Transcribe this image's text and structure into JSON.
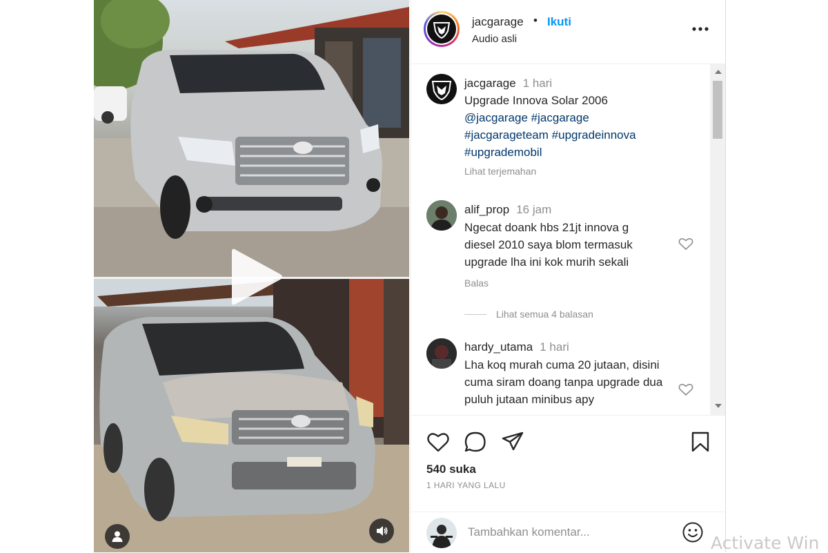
{
  "post": {
    "username": "jacgarage",
    "separator": "•",
    "follow_label": "Ikuti",
    "audio_label": "Audio asli",
    "more_icon": "more-horizontal-icon"
  },
  "caption": {
    "username": "jacgarage",
    "time": "1 hari",
    "title_line": "Upgrade Innova Solar 2006",
    "tags": [
      "@jacgarage",
      "#jacgarage",
      "#jacgarageteam",
      "#upgradeinnova",
      "#upgrademobil"
    ],
    "translate_label": "Lihat terjemahan"
  },
  "comments": [
    {
      "username": "alif_prop",
      "time": "16 jam",
      "text": "Ngecat doank hbs 21jt innova g diesel 2010 saya blom termasuk upgrade lha ini kok murih sekali",
      "reply_label": "Balas",
      "view_replies_label": "Lihat semua 4 balasan"
    },
    {
      "username": "hardy_utama",
      "time": "1 hari",
      "text": "Lha koq murah cuma 20 jutaan, disini cuma siram doang tanpa upgrade dua puluh jutaan minibus apy"
    }
  ],
  "actions": {
    "likes_label": "540 suka",
    "date_label": "1 HARI YANG LALU",
    "icons": [
      "heart-icon",
      "comment-icon",
      "share-icon",
      "bookmark-icon"
    ]
  },
  "add_comment": {
    "placeholder": "Tambahkan komentar...",
    "emoji_icon": "emoji-icon"
  },
  "watermark": "Activate Win",
  "colors": {
    "link_blue": "#0095f6",
    "hashtag": "#00376b",
    "muted": "#8e8e8e",
    "text": "#262626"
  }
}
